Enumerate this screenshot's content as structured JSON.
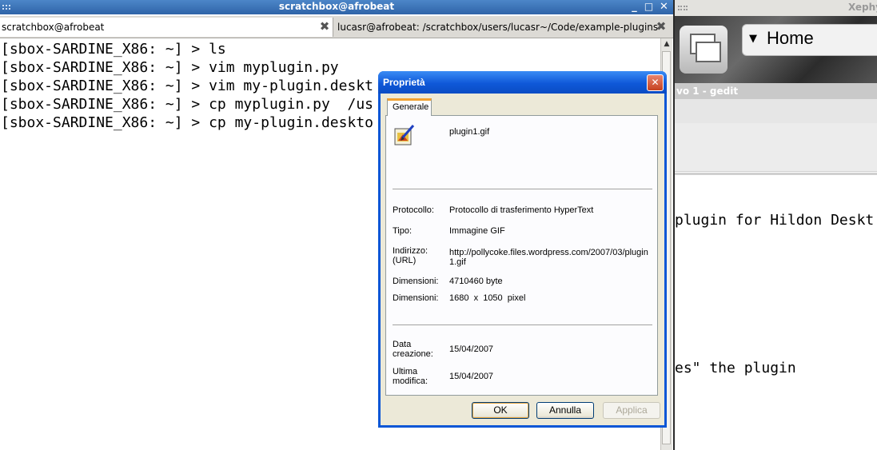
{
  "terminal": {
    "title": "scratchbox@afrobeat",
    "controls": {
      "minimize": "_",
      "maximize": "□",
      "close": "✕"
    },
    "tabs": [
      {
        "label": "scratchbox@afrobeat",
        "close": "✖"
      },
      {
        "label": "lucasr@afrobeat: /scratchbox/users/lucasr~/Code/example-plugins",
        "close": "✖"
      }
    ],
    "lines": [
      "[sbox-SARDINE_X86: ~] > ls",
      "[sbox-SARDINE_X86: ~] > vim myplugin.py",
      "[sbox-SARDINE_X86: ~] > vim my-plugin.deskt",
      "[sbox-SARDINE_X86: ~] > cp myplugin.py  /us",
      "[sbox-SARDINE_X86: ~] > cp my-plugin.deskto"
    ],
    "scroll_up": "▲"
  },
  "xephyr": {
    "title": "Xephy",
    "home_label": "Home",
    "home_caret": "▼",
    "gedit_title": "vo 1 - gedit",
    "doc_lines": [
      "plugin for Hildon Deskt",
      "es\" the plugin"
    ]
  },
  "dialog": {
    "title": "Proprietà",
    "close": "✕",
    "tab": "Generale",
    "file_name": "plugin1.gif",
    "rows": [
      {
        "label": "Protocollo:",
        "value": "Protocollo di trasferimento HyperText"
      },
      {
        "label": "Tipo:",
        "value": "Immagine GIF"
      },
      {
        "label": "Indirizzo:\n(URL)",
        "value": "http://pollycoke.files.wordpress.com/2007/03/plugin1.gif"
      },
      {
        "label": "Dimensioni:",
        "value": "4710460 byte"
      },
      {
        "label": "Dimensioni:",
        "value": "1680  x  1050  pixel"
      },
      {
        "label": "Data\ncreazione:",
        "value": "15/04/2007"
      },
      {
        "label": "Ultima\nmodifica:",
        "value": "15/04/2007"
      }
    ],
    "buttons": {
      "ok": "OK",
      "cancel": "Annulla",
      "apply": "Applica"
    }
  }
}
